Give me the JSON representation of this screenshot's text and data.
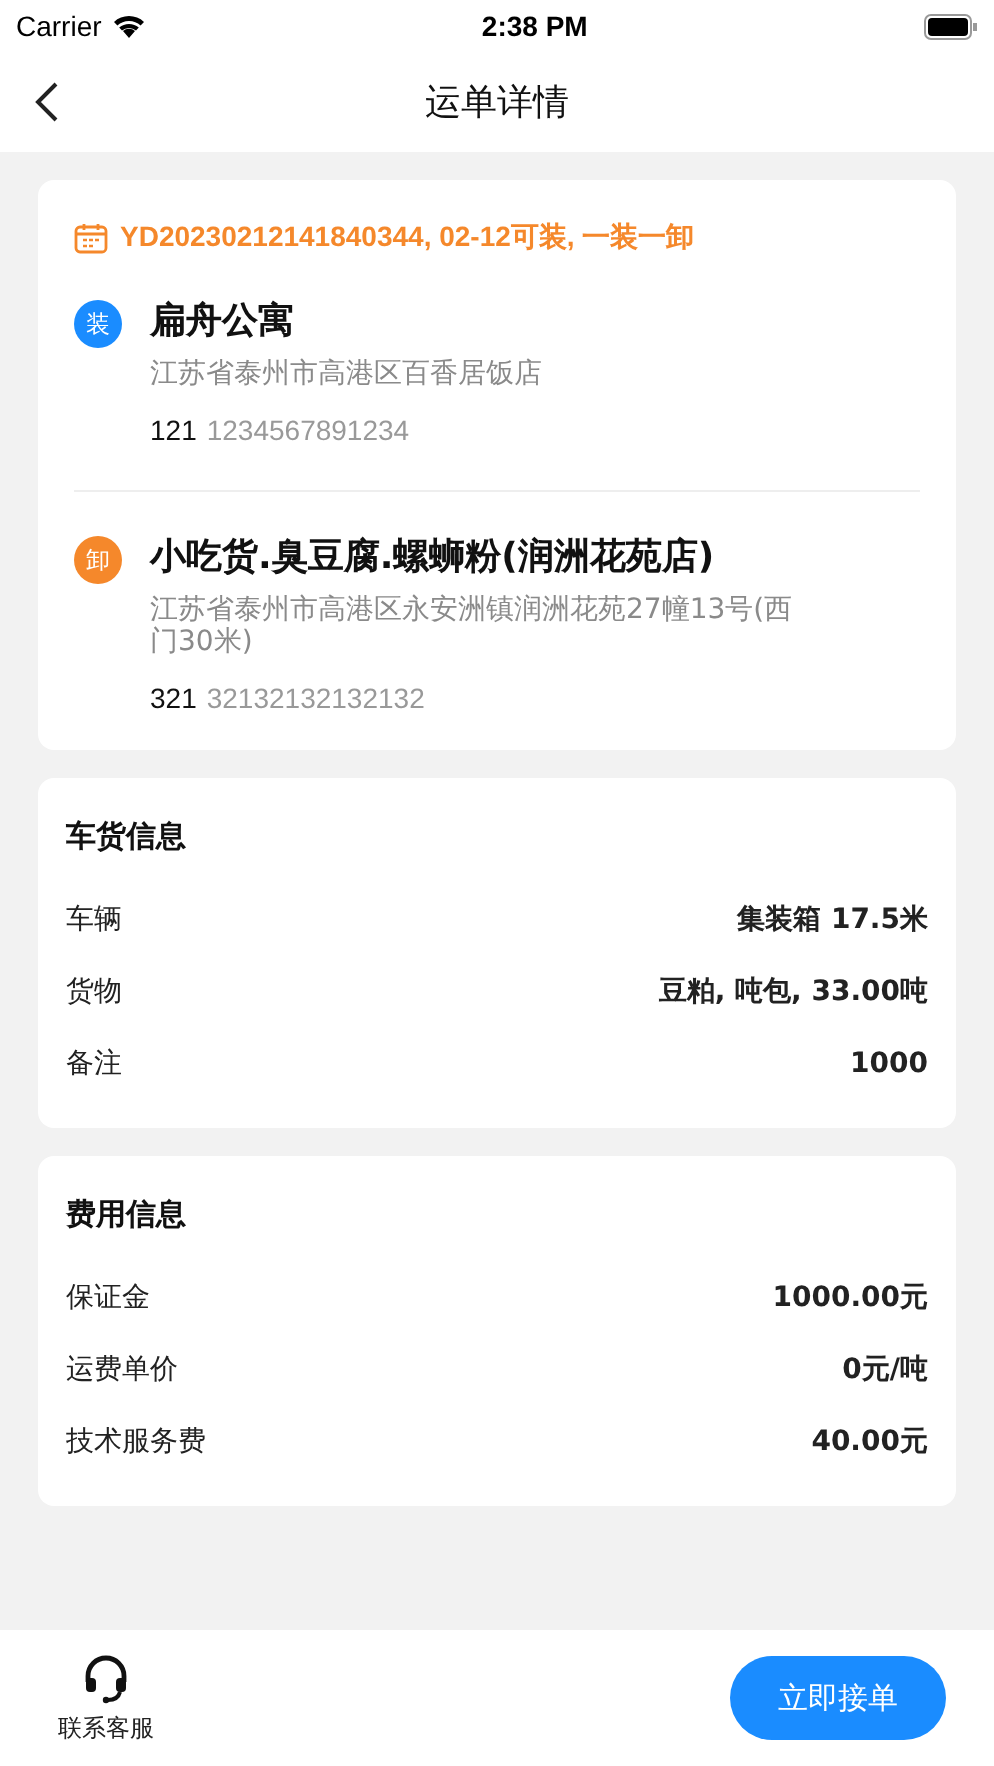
{
  "status_bar": {
    "carrier": "Carrier",
    "time": "2:38 PM"
  },
  "nav": {
    "title": "运单详情"
  },
  "waybill": {
    "header": "YD20230212141840344, 02-12可装, 一装一卸",
    "stops": [
      {
        "kind": "load",
        "badge": "装",
        "name": "扁舟公寓",
        "address": "江苏省泰州市高港区百香居饭店",
        "contact": "121",
        "phone": "1234567891234"
      },
      {
        "kind": "unload",
        "badge": "卸",
        "name": "小吃货.臭豆腐.螺蛳粉(润洲花苑店)",
        "address": "江苏省泰州市高港区永安洲镇润洲花苑27幢13号(西门30米)",
        "contact": "321",
        "phone": "32132132132132"
      }
    ]
  },
  "sections": [
    {
      "title": "车货信息",
      "rows": [
        {
          "label": "车辆",
          "value": "集装箱 17.5米"
        },
        {
          "label": "货物",
          "value": "豆粕, 吨包, 33.00吨"
        },
        {
          "label": "备注",
          "value": "1000"
        }
      ]
    },
    {
      "title": "费用信息",
      "rows": [
        {
          "label": "保证金",
          "value": "1000.00元"
        },
        {
          "label": "运费单价",
          "value": "0元/吨"
        },
        {
          "label": "技术服务费",
          "value": "40.00元"
        }
      ]
    }
  ],
  "bottom_bar": {
    "service_label": "联系客服",
    "primary_button": "立即接单"
  }
}
